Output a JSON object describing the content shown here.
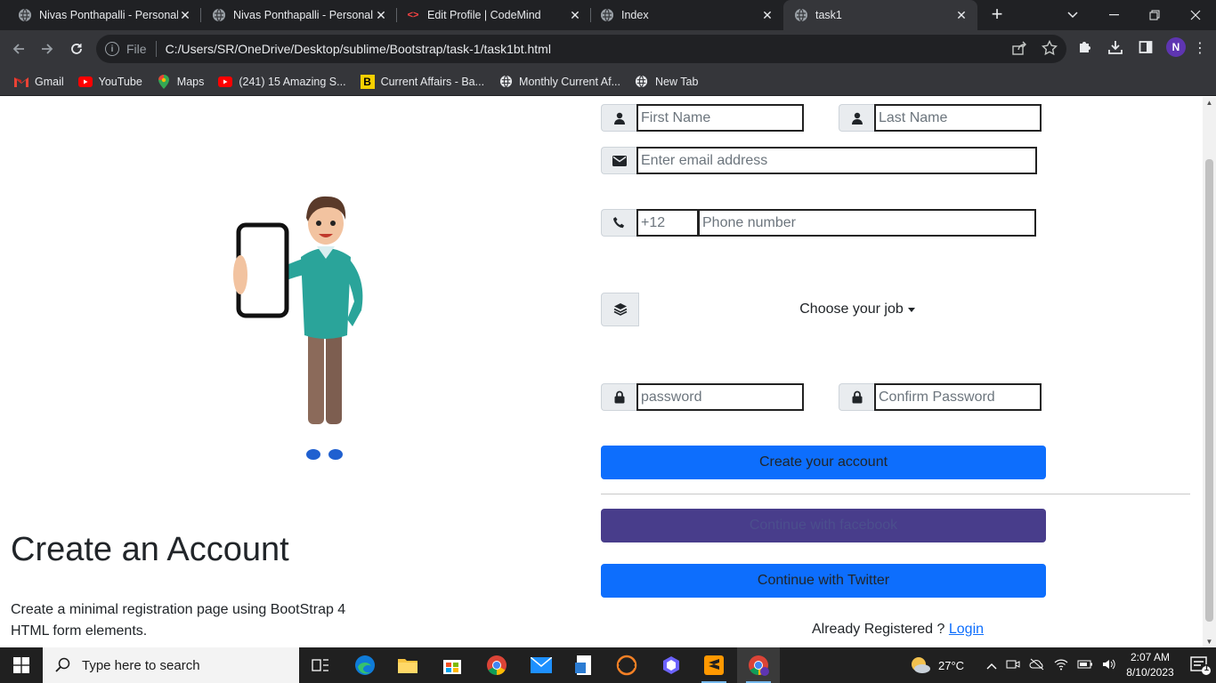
{
  "browser": {
    "tabs": [
      {
        "title": "Nivas Ponthapalli - Personal Careers",
        "icon": "globe-icon"
      },
      {
        "title": "Nivas Ponthapalli - Personal Careers",
        "icon": "globe-icon"
      },
      {
        "title": "Edit Profile | CodeMind",
        "icon": "code-icon"
      },
      {
        "title": "Index",
        "icon": "globe-icon"
      },
      {
        "title": "task1",
        "icon": "globe-icon"
      }
    ],
    "address": {
      "scheme_label": "File",
      "url": "C:/Users/SR/OneDrive/Desktop/sublime/Bootstrap/task-1/task1bt.html"
    },
    "profile_initial": "N",
    "bookmarks": [
      {
        "label": "Gmail",
        "icon": "gmail-icon"
      },
      {
        "label": "YouTube",
        "icon": "youtube-icon"
      },
      {
        "label": "Maps",
        "icon": "maps-icon"
      },
      {
        "label": "(241) 15 Amazing S...",
        "icon": "youtube-icon"
      },
      {
        "label": "Current Affairs - Ba...",
        "icon": "bookmark-b-icon"
      },
      {
        "label": "Monthly Current Af...",
        "icon": "globe-icon"
      },
      {
        "label": "New Tab",
        "icon": "globe-icon"
      }
    ]
  },
  "page": {
    "heading": "Create an Account",
    "description": "Create a minimal registration page using BootStrap 4 HTML form elements.",
    "form": {
      "first_name_placeholder": "First Name",
      "last_name_placeholder": "Last Name",
      "email_placeholder": "Enter email address",
      "country_code_placeholder": "+12",
      "phone_placeholder": "Phone number",
      "job_label": "Choose your job",
      "password_placeholder": "password",
      "confirm_password_placeholder": "Confirm Password",
      "create_button": "Create your account",
      "facebook_button": "Continue with facebook",
      "twitter_button": "Continue with Twitter",
      "already_registered": "Already Registered ?",
      "login_link": "Login"
    },
    "colors": {
      "primary": "#0d6efd",
      "facebook": "#483d8b"
    }
  },
  "taskbar": {
    "search_placeholder": "Type here to search",
    "weather": "27°C",
    "time": "2:07 AM",
    "date": "8/10/2023",
    "notification_count": "1"
  }
}
